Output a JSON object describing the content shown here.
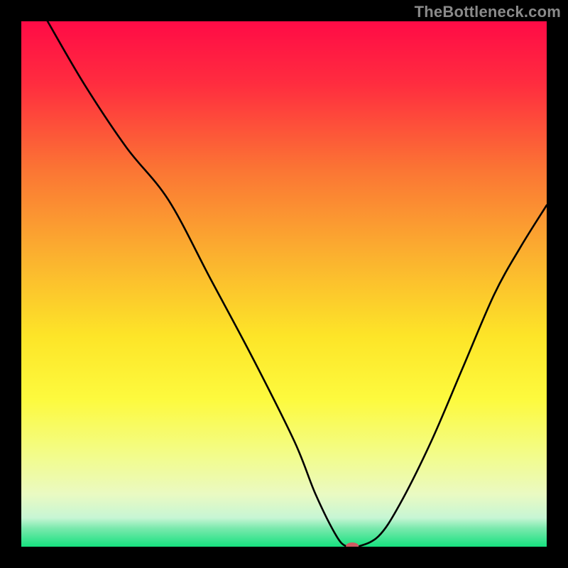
{
  "watermark": "TheBottleneck.com",
  "chart_data": {
    "type": "line",
    "title": "",
    "xlabel": "",
    "ylabel": "",
    "xlim": [
      0,
      100
    ],
    "ylim": [
      0,
      100
    ],
    "background_gradient": {
      "stops": [
        {
          "offset": 0.0,
          "color": "#ff0b46"
        },
        {
          "offset": 0.12,
          "color": "#ff2d3f"
        },
        {
          "offset": 0.28,
          "color": "#fb7434"
        },
        {
          "offset": 0.45,
          "color": "#fbb22f"
        },
        {
          "offset": 0.6,
          "color": "#fde528"
        },
        {
          "offset": 0.72,
          "color": "#fdfa3e"
        },
        {
          "offset": 0.82,
          "color": "#f3fc86"
        },
        {
          "offset": 0.9,
          "color": "#eafac2"
        },
        {
          "offset": 0.945,
          "color": "#c7f6d4"
        },
        {
          "offset": 0.965,
          "color": "#7ae9ad"
        },
        {
          "offset": 1.0,
          "color": "#16e17f"
        }
      ]
    },
    "series": [
      {
        "name": "bottleneck-curve",
        "x": [
          5,
          12,
          20,
          28,
          36,
          44,
          52,
          56,
          60,
          62,
          64,
          68,
          72,
          78,
          84,
          90,
          95,
          100
        ],
        "y": [
          100,
          88,
          76,
          66,
          51,
          36,
          20,
          10,
          2,
          0,
          0,
          2,
          8,
          20,
          34,
          48,
          57,
          65
        ]
      }
    ],
    "marker": {
      "name": "optimal-point",
      "x": 63,
      "y": 0,
      "color": "#cf5b62",
      "rx": 9,
      "ry": 5
    }
  }
}
